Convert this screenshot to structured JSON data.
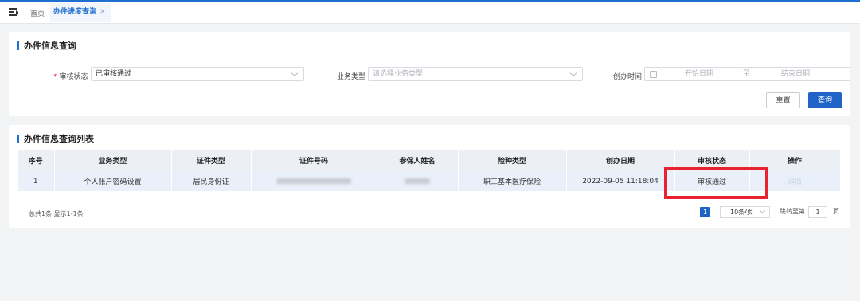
{
  "tabs": {
    "home": "首页",
    "active": "办件进度查询",
    "close": "×"
  },
  "search": {
    "title": "办件信息查询",
    "status_label": "审核状态",
    "status_required": "*",
    "status_value": "已审核通过",
    "biz_type_label": "业务类型",
    "biz_type_placeholder": "请选择业务类型",
    "date_label": "创办时间",
    "date_start": "开始日期",
    "date_sep": "至",
    "date_end": "结束日期",
    "reset_label": "重置",
    "query_label": "查询"
  },
  "list": {
    "title": "办件信息查询列表",
    "columns": [
      "序号",
      "业务类型",
      "证件类型",
      "证件号码",
      "参保人姓名",
      "险种类型",
      "创办日期",
      "审核状态",
      "操作"
    ],
    "rows": [
      {
        "index": "1",
        "biz_type": "个人账户密码设置",
        "id_type": "居民身份证",
        "insurance": "职工基本医疗保险",
        "date": "2022-09-05 11:18:04",
        "status": "审核通过",
        "action": "详情"
      }
    ],
    "summary": "总共1条 显示1-1条",
    "pager": {
      "current": "1",
      "page_size": "10条/页",
      "jump_prefix": "跳转至第",
      "jump_value": "1",
      "jump_suffix": "页"
    }
  },
  "colors": {
    "accent": "#1f63c6",
    "highlight": "#e8222f"
  }
}
